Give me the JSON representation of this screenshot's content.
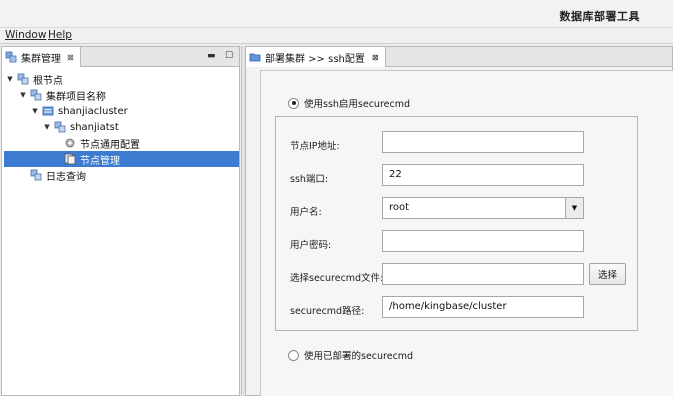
{
  "window": {
    "title": "数据库部署工具"
  },
  "menubar": {
    "items": [
      "Window",
      "Help"
    ]
  },
  "left_view": {
    "tab_label": "集群管理",
    "tab_close": "⊠",
    "minimize": "▬",
    "maximize": "☐"
  },
  "tree": {
    "root": "根节点",
    "project": "集群项目名称",
    "cluster": "shanjiacluster",
    "host": "shanjiatst",
    "node_common_config": "节点通用配置",
    "node_manage": "节点管理",
    "log_query": "日志查询"
  },
  "editor": {
    "tab_label": "部署集群 >> ssh配置",
    "tab_close": "⊠"
  },
  "form": {
    "option_ssh": "使用ssh启用securecmd",
    "option_deployed": "使用已部署的securecmd",
    "ip_label": "节点IP地址:",
    "ip_value": "",
    "port_label": "ssh端口:",
    "port_value": "22",
    "user_label": "用户名:",
    "user_value": "root",
    "password_label": "用户密码:",
    "password_value": "",
    "file_label": "选择securecmd文件:",
    "file_value": "",
    "choose_button": "选择",
    "path_label": "securecmd路径:",
    "path_value": "/home/kingbase/cluster"
  },
  "icons": {
    "view": "cluster-view-icon",
    "folder": "folder-icon",
    "gear": "gear-icon",
    "server": "server-icon"
  }
}
